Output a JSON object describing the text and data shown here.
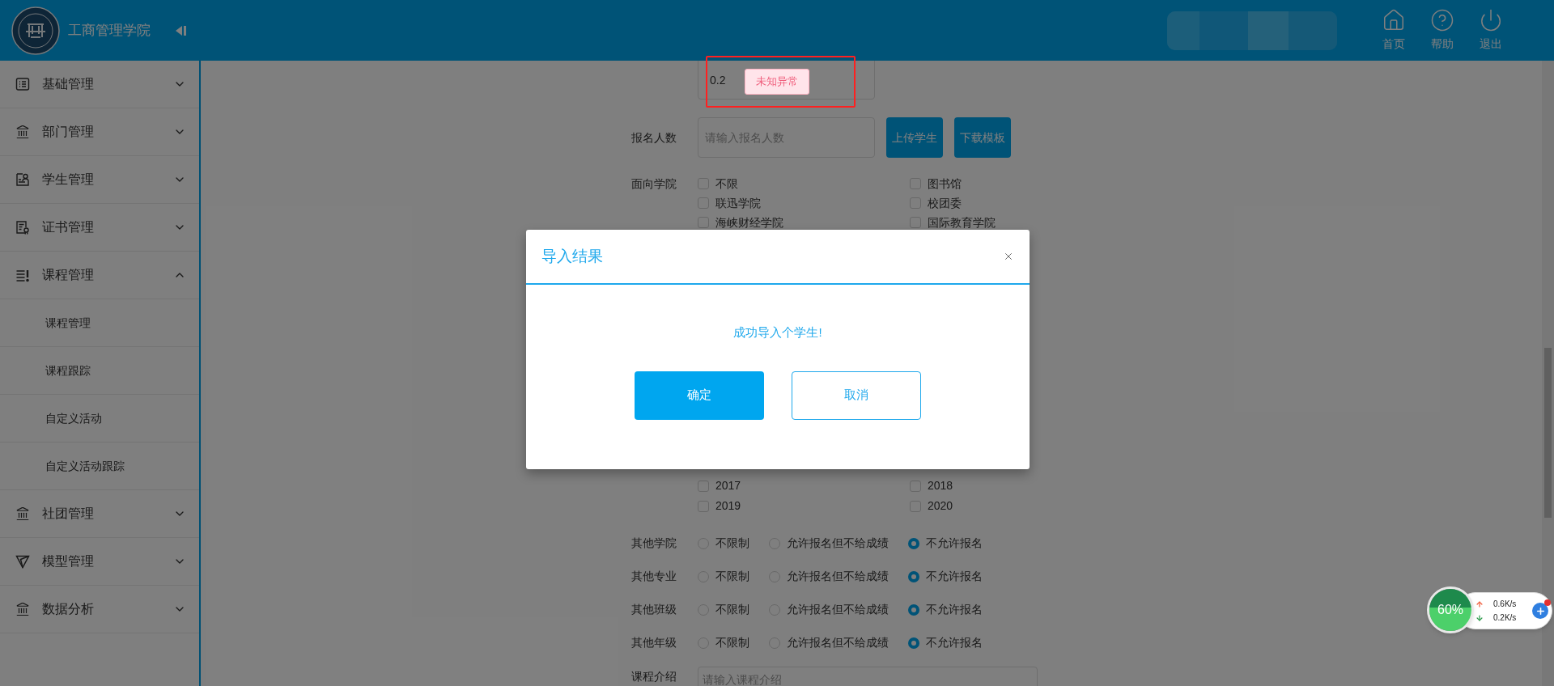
{
  "header": {
    "title": "工商管理学院",
    "actions": [
      {
        "label": "首页",
        "kind": "home"
      },
      {
        "label": "帮助",
        "kind": "help"
      },
      {
        "label": "退出",
        "kind": "logout"
      }
    ]
  },
  "sidebar": {
    "items": [
      {
        "label": "基础管理",
        "kind": "list",
        "expanded": false
      },
      {
        "label": "部门管理",
        "kind": "bank",
        "expanded": false
      },
      {
        "label": "学生管理",
        "kind": "student",
        "expanded": false
      },
      {
        "label": "证书管理",
        "kind": "certificate",
        "expanded": false
      },
      {
        "label": "课程管理",
        "kind": "course",
        "expanded": true,
        "children": [
          {
            "label": "课程管理"
          },
          {
            "label": "课程跟踪"
          },
          {
            "label": "自定义活动"
          },
          {
            "label": "自定义活动跟踪"
          }
        ]
      },
      {
        "label": "社团管理",
        "kind": "bank",
        "expanded": false
      },
      {
        "label": "模型管理",
        "kind": "model",
        "expanded": false
      },
      {
        "label": "数据分析",
        "kind": "bank",
        "expanded": false
      }
    ]
  },
  "form": {
    "partial_field": {
      "value": "0.2"
    },
    "enroll": {
      "label": "报名人数",
      "placeholder": "请输入报名人数",
      "buttons": [
        "上传学生",
        "下载模板"
      ]
    },
    "colleges": {
      "label": "面向学院",
      "options": [
        {
          "label": "不限",
          "checked": false
        },
        {
          "label": "图书馆",
          "checked": false
        },
        {
          "label": "联迅学院",
          "checked": false
        },
        {
          "label": "校团委",
          "checked": false
        },
        {
          "label": "海峡财经学院",
          "checked": false
        },
        {
          "label": "国际教育学院",
          "checked": false
        }
      ]
    },
    "years": {
      "options": [
        {
          "label": "2017",
          "checked": false
        },
        {
          "label": "2018",
          "checked": false
        },
        {
          "label": "2019",
          "checked": false
        },
        {
          "label": "2020",
          "checked": false
        }
      ]
    },
    "restrictions": [
      {
        "label": "其他学院",
        "options": [
          {
            "label": "不限制",
            "selected": false
          },
          {
            "label": "允许报名但不给成绩",
            "selected": false
          },
          {
            "label": "不允许报名",
            "selected": true
          }
        ]
      },
      {
        "label": "其他专业",
        "options": [
          {
            "label": "不限制",
            "selected": false
          },
          {
            "label": "允许报名但不给成绩",
            "selected": false
          },
          {
            "label": "不允许报名",
            "selected": true
          }
        ]
      },
      {
        "label": "其他班级",
        "options": [
          {
            "label": "不限制",
            "selected": false
          },
          {
            "label": "允许报名但不给成绩",
            "selected": false
          },
          {
            "label": "不允许报名",
            "selected": true
          }
        ]
      },
      {
        "label": "其他年级",
        "options": [
          {
            "label": "不限制",
            "selected": false
          },
          {
            "label": "允许报名但不给成绩",
            "selected": false
          },
          {
            "label": "不允许报名",
            "selected": true
          }
        ]
      }
    ],
    "intro": {
      "label": "课程介绍",
      "placeholder": "请输入课程介绍"
    }
  },
  "toast": {
    "text": "未知异常"
  },
  "dialog": {
    "title": "导入结果",
    "message": "成功导入个学生!",
    "buttons": [
      {
        "label": "确定",
        "kind": "primary"
      },
      {
        "label": "取消",
        "kind": "secondary"
      }
    ]
  },
  "speed_widget": {
    "percent": "60%",
    "upload": "0.6K/s",
    "download": "0.2K/s"
  }
}
